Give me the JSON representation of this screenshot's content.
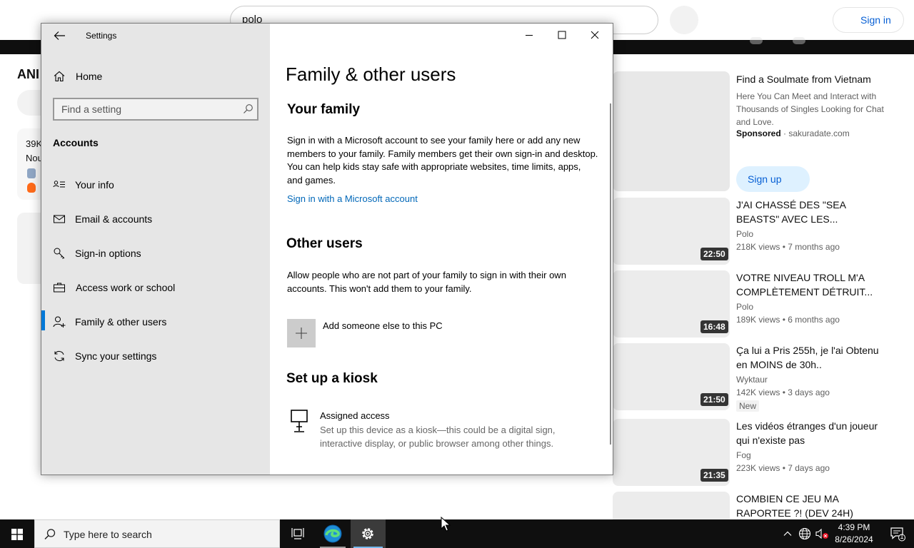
{
  "browser": {
    "search_value": "polo",
    "sign_in": "Sign in",
    "left_title": "ANI",
    "left_card_line1": "39K",
    "left_card_line2": "Nou",
    "ad": {
      "title": "Find a Soulmate from Vietnam",
      "description": "Here You Can Meet and Interact with Thousands of Singles Looking for Chat and Love.",
      "sponsored": "Sponsored",
      "domain": " · sakuradate.com",
      "button": "Sign up"
    },
    "videos": [
      {
        "title": "J'AI CHASSÉ DES \"SEA BEASTS\" AVEC LES...",
        "channel": "Polo",
        "meta": "218K views • 7 months ago",
        "duration": "22:50",
        "badge": ""
      },
      {
        "title": "VOTRE NIVEAU TROLL M'A COMPLÈTEMENT DÉTRUIT...",
        "channel": "Polo",
        "meta": "189K views • 6 months ago",
        "duration": "16:48",
        "badge": ""
      },
      {
        "title": "Ça lui a Pris 255h, je l'ai Obtenu en MOINS de 30h..",
        "channel": "Wyktaur",
        "meta": "142K views • 3 days ago",
        "duration": "21:50",
        "badge": "New"
      },
      {
        "title": "Les vidéos étranges d'un joueur qui n'existe pas",
        "channel": "Fog",
        "meta": "223K views • 7 days ago",
        "duration": "21:35",
        "badge": ""
      },
      {
        "title": "COMBIEN CE JEU MA RAPORTEE ?! (DEV 24H)",
        "channel": "",
        "meta": "",
        "duration": "",
        "badge": ""
      }
    ]
  },
  "settings": {
    "app_title": "Settings",
    "home": "Home",
    "search_placeholder": "Find a setting",
    "section": "Accounts",
    "nav_items": [
      {
        "label": "Your info",
        "icon": "contact-card-icon"
      },
      {
        "label": "Email & accounts",
        "icon": "mail-icon"
      },
      {
        "label": "Sign-in options",
        "icon": "key-icon"
      },
      {
        "label": "Access work or school",
        "icon": "briefcase-icon"
      },
      {
        "label": "Family & other users",
        "icon": "add-person-icon",
        "active": true
      },
      {
        "label": "Sync your settings",
        "icon": "sync-icon"
      }
    ],
    "page_title": "Family & other users",
    "your_family": {
      "heading": "Your family",
      "body": "Sign in with a Microsoft account to see your family here or add any new members to your family. Family members get their own sign-in and desktop. You can help kids stay safe with appropriate websites, time limits, apps, and games.",
      "link": "Sign in with a Microsoft account"
    },
    "other_users": {
      "heading": "Other users",
      "body": "Allow people who are not part of your family to sign in with their own accounts. This won't add them to your family.",
      "add_label": "Add someone else to this PC"
    },
    "kiosk": {
      "heading": "Set up a kiosk",
      "title": "Assigned access",
      "description": "Set up this device as a kiosk—this could be a digital sign, interactive display, or public browser among other things."
    }
  },
  "taskbar": {
    "search_text": "Type here to search",
    "time": "4:39 PM",
    "date": "8/26/2024",
    "notification_count": "1"
  },
  "colors": {
    "accent": "#0078d7",
    "link": "#0067b8",
    "taskbar": "#0f0f0f"
  }
}
